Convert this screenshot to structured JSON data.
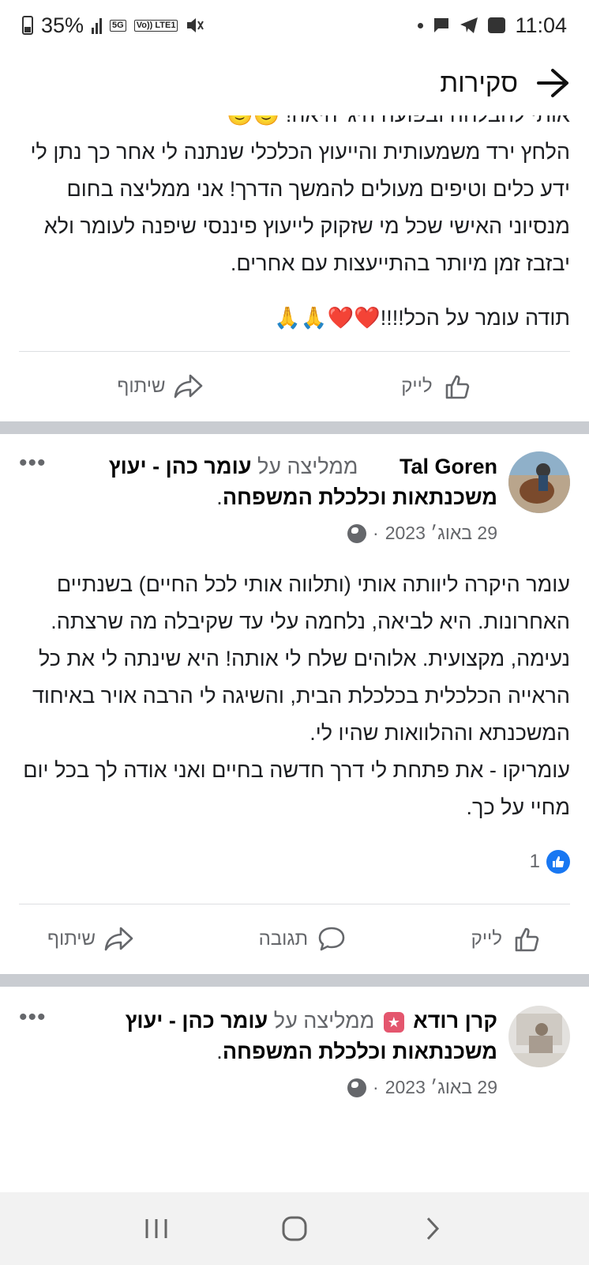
{
  "status": {
    "battery": "35%",
    "net_5g": "5G",
    "net_volte": "Vo)) LTE1",
    "time": "11:04"
  },
  "header": {
    "title": "סקירות"
  },
  "review1": {
    "cut_text": "אותי להבלחה ובפועה היג' היאה! 🙂🙂",
    "text": "הלחץ ירד משמעותית והייעוץ הכלכלי שנתנה לי אחר כך נתן לי ידע כלים וטיפים מעולים להמשך הדרך! אני ממליצה בחום מנסיוני האישי שכל מי שזקוק לייעוץ פיננסי שיפנה לעומר ולא יבזבז זמן מיותר בהתייעצות עם אחרים.",
    "thanks": "תודה עומר על הכל!!!!❤️❤️🙏🙏",
    "like_label": "לייק",
    "share_label": "שיתוף"
  },
  "review2": {
    "author": "Tal Goren",
    "verb": "ממליצה על",
    "page_name": "עומר כהן - יעוץ משכנתאות וכלכלת המשפחה",
    "date": "29 באוג׳ 2023",
    "more": "•••",
    "text": "עומר היקרה ליוותה אותי (ותלווה אותי לכל החיים) בשנתיים האחרונות. היא לביאה, נלחמה עלי עד שקיבלה מה שרצתה. נעימה, מקצועית. אלוהים שלח לי אותה! היא שינתה לי את כל הראייה הכלכלית בכלכלת הבית, והשיגה לי הרבה אויר באיחוד המשכנתא וההלוואות שהיו לי.",
    "text2": "עומריקו - את פתחת לי דרך חדשה בחיים ואני אודה לך בכל יום מחיי על כך.",
    "like_count": "1",
    "like_label": "לייק",
    "comment_label": "תגובה",
    "share_label": "שיתוף"
  },
  "review3": {
    "author": "קרן רודא",
    "badge": "★",
    "verb": "ממליצה על",
    "page_name": "עומר כהן - יעוץ משכנתאות וכלכלת המשפחה",
    "date": "29 באוג׳ 2023",
    "more": "•••"
  },
  "colors": {
    "facebook_blue": "#1877f2",
    "muted": "#65676b",
    "separator": "#c9ccd1"
  }
}
